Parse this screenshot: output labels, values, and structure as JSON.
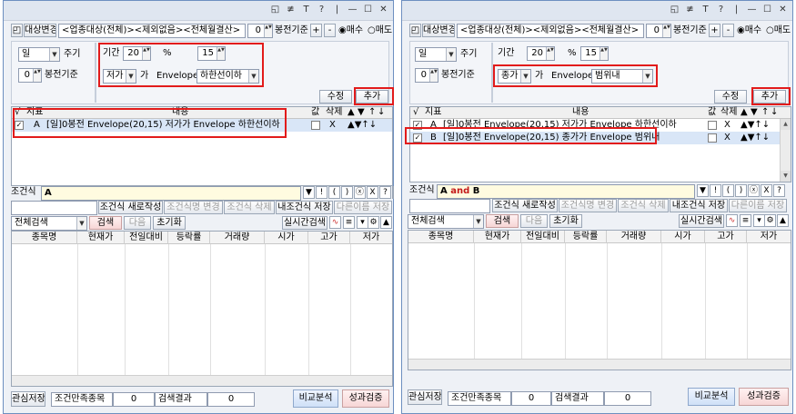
{
  "colors": {
    "highlight": "#e21b1b",
    "selection": "#d9e6f7",
    "accent_blue": "#cfe0f7",
    "accent_pink": "#f7d6d6"
  },
  "titlebar": {
    "icons": [
      "restore-icon",
      "pin-icon",
      "font-icon",
      "help-icon",
      "minimize-icon",
      "maximize-icon",
      "close-icon"
    ],
    "glyphs": [
      "◱",
      "≢",
      "T",
      "?",
      "|",
      "—",
      "☐",
      "✕"
    ]
  },
  "toolbar": {
    "change_target": "대상변경",
    "target_text": "<업종대상(전체)><제외없음><전체월결산>",
    "bong_value": "0",
    "bong_label": "봉전기준",
    "plus": "+",
    "minus": "-",
    "buy_label": "매수",
    "sell_label": "매도"
  },
  "left": {
    "period_type": "일",
    "cycle_label": "주기",
    "bong_value": "0",
    "bong_label": "봉전기준",
    "period_label": "기간",
    "period_value": "20",
    "percent_label": "%",
    "percent_value": "15",
    "price_field": "저가",
    "ga": "가",
    "envelope": "Envelope",
    "condition": "하한선이하",
    "edit": "수정",
    "add": "추가",
    "list_headers": [
      "√",
      "지표",
      "내용",
      "값",
      "삭제",
      "▲",
      "▼",
      "↑",
      "↓"
    ],
    "rows": [
      {
        "checked": "✓",
        "key": "A",
        "content": "[일]0봉전 Envelope(20,15) 저가가 Envelope 하한선이하",
        "delete": "X",
        "arrows": "▲▼↑↓"
      }
    ],
    "formula_label": "조건식",
    "formula": "A",
    "formula_buttons": [
      "▼",
      "!",
      "(",
      ")",
      "ⓧ",
      "X",
      "?"
    ],
    "new_formula": "조건식 새로작성",
    "rename_formula": "조건식명 변경",
    "delete_formula": "조건식 삭제",
    "save_mine": "내조건식 저장",
    "save_as": "다른이름 저장",
    "search_scope": "전체검색",
    "search": "검색",
    "next": "다음",
    "reset": "초기화",
    "realtime": "실시간검색",
    "columns": [
      "종목명",
      "현재가",
      "전일대비",
      "등락률",
      "거래량",
      "시가",
      "고가",
      "저가"
    ],
    "footer": {
      "save_interest": "관심저장",
      "match_label": "조건만족종목",
      "match_count": "0",
      "result_label": "검색결과",
      "result_count": "0",
      "compare": "비교분석",
      "performance": "성과검증"
    }
  },
  "right": {
    "period_type": "일",
    "cycle_label": "주기",
    "bong_value": "0",
    "bong_label": "봉전기준",
    "period_label": "기간",
    "period_value": "20",
    "percent_label": "%",
    "percent_value": "15",
    "price_field": "종가",
    "ga": "가",
    "envelope": "Envelope",
    "condition": "범위내",
    "edit": "수정",
    "add": "추가",
    "list_headers": [
      "√",
      "지표",
      "내용",
      "값",
      "삭제",
      "▲",
      "▼",
      "↑",
      "↓"
    ],
    "rows": [
      {
        "checked": "✓",
        "key": "A",
        "content": "[일]0봉전 Envelope(20,15) 저가가 Envelope 하한선이하",
        "delete": "X",
        "arrows": "▲▼↑↓"
      },
      {
        "checked": "✓",
        "key": "B",
        "content": "[일]0봉전 Envelope(20,15) 종가가 Envelope 범위내",
        "delete": "X",
        "arrows": "▲▼↑↓"
      }
    ],
    "formula_label": "조건식",
    "formula_a": "A",
    "formula_and": "and",
    "formula_b": "B",
    "formula_buttons": [
      "▼",
      "!",
      "(",
      ")",
      "ⓧ",
      "X",
      "?"
    ],
    "new_formula": "조건식 새로작성",
    "rename_formula": "조건식명 변경",
    "delete_formula": "조건식 삭제",
    "save_mine": "내조건식 저장",
    "save_as": "다른이름 저장",
    "search_scope": "전체검색",
    "search": "검색",
    "next": "다음",
    "reset": "초기화",
    "realtime": "실시간검색",
    "columns": [
      "종목명",
      "현재가",
      "전일대비",
      "등락률",
      "거래량",
      "시가",
      "고가",
      "저가"
    ],
    "footer": {
      "save_interest": "관심저장",
      "match_label": "조건만족종목",
      "match_count": "0",
      "result_label": "검색결과",
      "result_count": "0",
      "compare": "비교분석",
      "performance": "성과검증"
    }
  }
}
